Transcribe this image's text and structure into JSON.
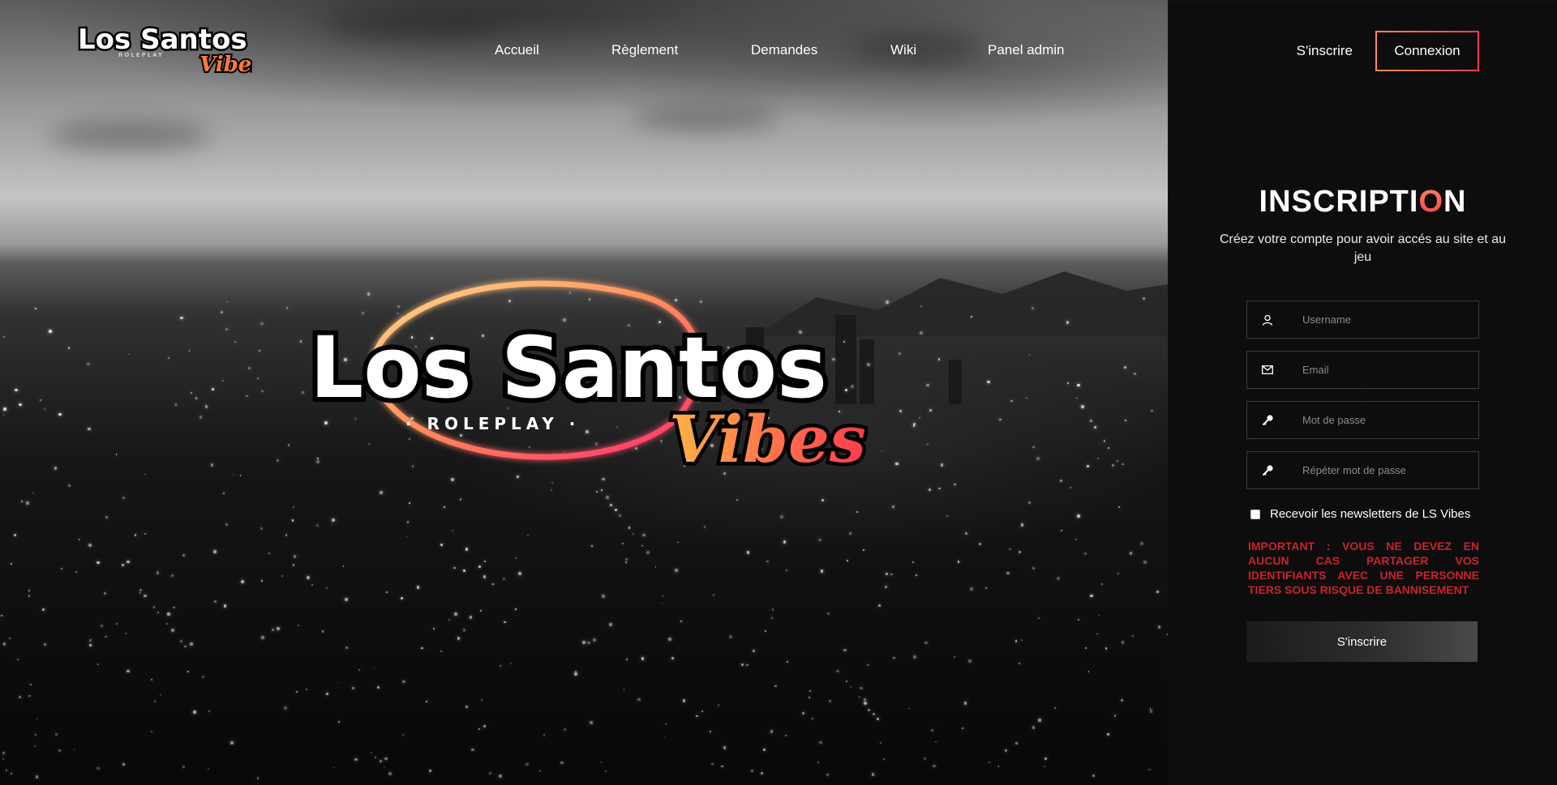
{
  "brand": {
    "logo_text_main": "Los Santos",
    "logo_text_sub": "ROLEPLAY",
    "logo_text_script": "Vibes"
  },
  "nav": {
    "links": [
      "Accueil",
      "Règlement",
      "Demandes",
      "Wiki",
      "Panel admin"
    ]
  },
  "auth": {
    "signup_label": "S'inscrire",
    "login_label": "Connexion"
  },
  "hero": {
    "logo_main": "Los Santos",
    "logo_sub": "· ROLEPLAY ·",
    "logo_script": "Vibes"
  },
  "form": {
    "title_prefix": "INSCRIPTI",
    "title_o": "O",
    "title_suffix": "N",
    "subtitle": "Créez votre compte pour avoir accés au site et au jeu",
    "fields": [
      {
        "placeholder": "Username",
        "icon": "user-icon"
      },
      {
        "placeholder": "Email",
        "icon": "mail-icon"
      },
      {
        "placeholder": "Mot de passe",
        "icon": "key-icon"
      },
      {
        "placeholder": "Répéter mot de passe",
        "icon": "key-icon"
      }
    ],
    "newsletter_label": "Recevoir les newsletters de LS Vibes",
    "newsletter_checked": false,
    "warning": "IMPORTANT : VOUS NE DEVEZ EN AUCUN CAS PARTAGER VOS IDENTIFIANTS AVEC UNE PERSONNE TIERS SOUS RISQUE DE BANNISEMENT",
    "submit_label": "S'inscrire"
  },
  "colors": {
    "accent_start": "#ff8a5c",
    "accent_end": "#ff3b4e",
    "warning": "#c7242b",
    "panel_bg": "#0d0d0e"
  }
}
